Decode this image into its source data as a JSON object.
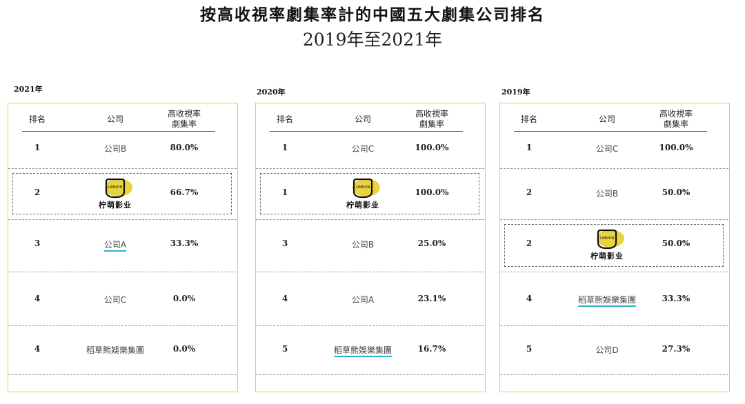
{
  "title": "按高收視率劇集率計的中國五大劇集公司排名",
  "subtitle": "2019年至2021年",
  "headers": {
    "rank": "排名",
    "company": "公司",
    "rate_line1": "高收視率",
    "rate_line2": "劇集率"
  },
  "logo": {
    "text": "柠萌影业",
    "badge": "LIMMON"
  },
  "colors": {
    "panel_border": "#f2c84b",
    "logo_yellow": "#e8d43c",
    "underline": "#2bb3c8"
  },
  "panels": [
    {
      "year": "2021年",
      "rows": [
        {
          "rank": "1",
          "company": "公司B",
          "value": "80.0%"
        },
        {
          "rank": "2",
          "company": "",
          "value": "66.7%",
          "logo": true
        },
        {
          "rank": "3",
          "company": "公司A",
          "value": "33.3%"
        },
        {
          "rank": "4",
          "company": "公司C",
          "value": "0.0%"
        },
        {
          "rank": "4",
          "company": "稻草熊娛樂集團",
          "value": "0.0%"
        }
      ]
    },
    {
      "year": "2020年",
      "rows": [
        {
          "rank": "1",
          "company": "公司C",
          "value": "100.0%"
        },
        {
          "rank": "1",
          "company": "",
          "value": "100.0%",
          "logo": true
        },
        {
          "rank": "3",
          "company": "公司B",
          "value": "25.0%"
        },
        {
          "rank": "4",
          "company": "公司A",
          "value": "23.1%"
        },
        {
          "rank": "5",
          "company": "稻草熊娛樂集團",
          "value": "16.7%"
        }
      ]
    },
    {
      "year": "2019年",
      "rows": [
        {
          "rank": "1",
          "company": "公司C",
          "value": "100.0%"
        },
        {
          "rank": "2",
          "company": "公司B",
          "value": "50.0%"
        },
        {
          "rank": "2",
          "company": "",
          "value": "50.0%",
          "logo": true
        },
        {
          "rank": "4",
          "company": "稻草熊娛樂集團",
          "value": "33.3%"
        },
        {
          "rank": "5",
          "company": "公司D",
          "value": "27.3%"
        }
      ]
    }
  ]
}
